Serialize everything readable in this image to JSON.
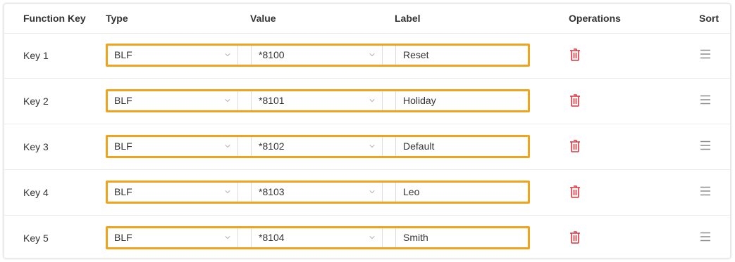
{
  "table": {
    "headers": {
      "function_key": "Function Key",
      "type": "Type",
      "value": "Value",
      "label": "Label",
      "operations": "Operations",
      "sort": "Sort"
    },
    "rows": [
      {
        "key": "Key 1",
        "type": "BLF",
        "value": "*8100",
        "label": "Reset"
      },
      {
        "key": "Key 2",
        "type": "BLF",
        "value": "*8101",
        "label": "Holiday"
      },
      {
        "key": "Key 3",
        "type": "BLF",
        "value": "*8102",
        "label": "Default"
      },
      {
        "key": "Key 4",
        "type": "BLF",
        "value": "*8103",
        "label": "Leo"
      },
      {
        "key": "Key 5",
        "type": "BLF",
        "value": "*8104",
        "label": "Smith"
      }
    ]
  },
  "colors": {
    "highlight": "#f0a41e",
    "delete_icon": "#d9363e",
    "sort_icon": "#8c8c8c"
  },
  "icons": {
    "operations": "trash-icon",
    "sort": "drag-handle-icon",
    "dropdown": "chevron-down-icon"
  }
}
